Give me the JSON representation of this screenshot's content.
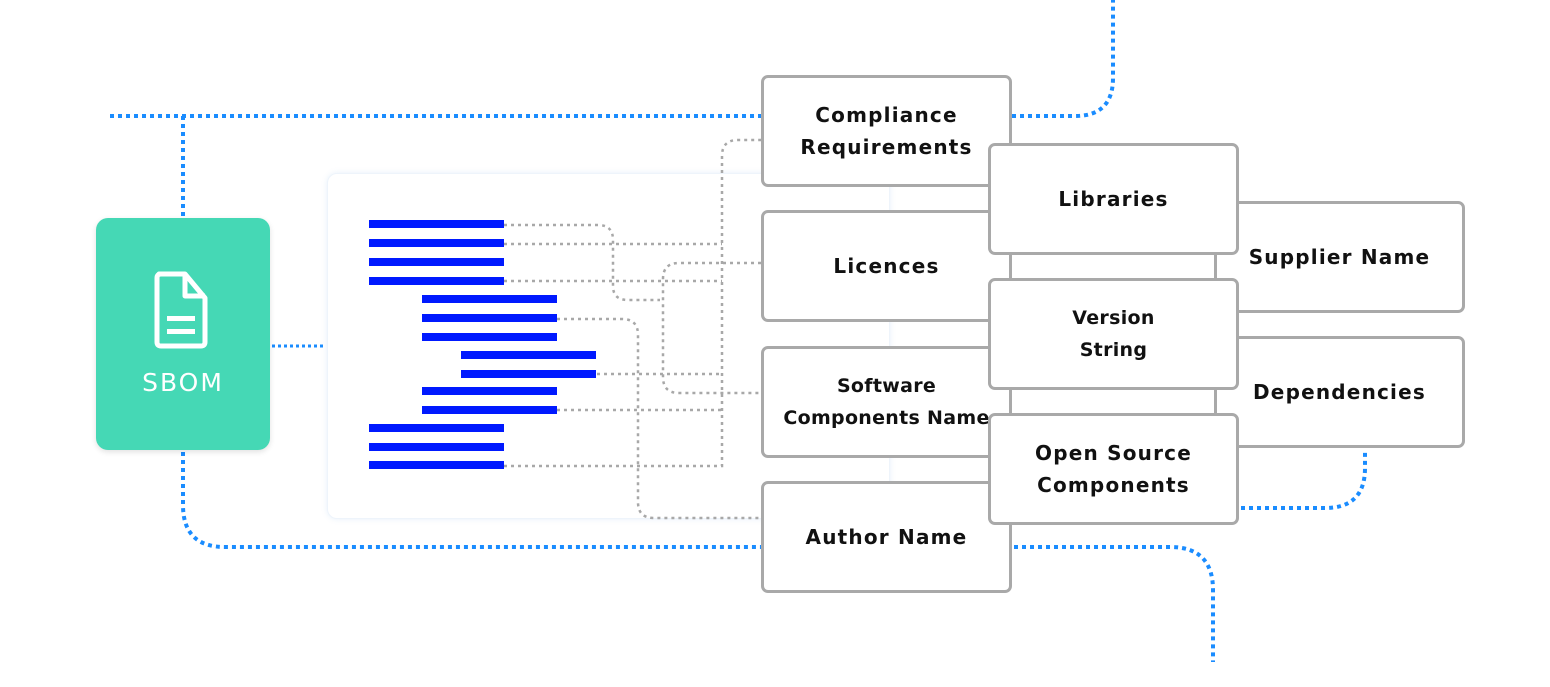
{
  "sbom": {
    "label": "SBOM",
    "icon": "document-icon",
    "color": "#45d8b5"
  },
  "colors": {
    "connector_blue": "#1a8cff",
    "connector_gray": "#a8a8a8",
    "bar_blue": "#0019ff"
  },
  "boxes": {
    "compliance": "Compliance\nRequirements",
    "licences": "Licences",
    "software": "Software\nComponents Name",
    "author": "Author Name",
    "libraries": "Libraries",
    "version": "Version\nString",
    "open_source": "Open Source\nComponents",
    "supplier": "Supplier Name",
    "dependencies": "Dependencies"
  }
}
